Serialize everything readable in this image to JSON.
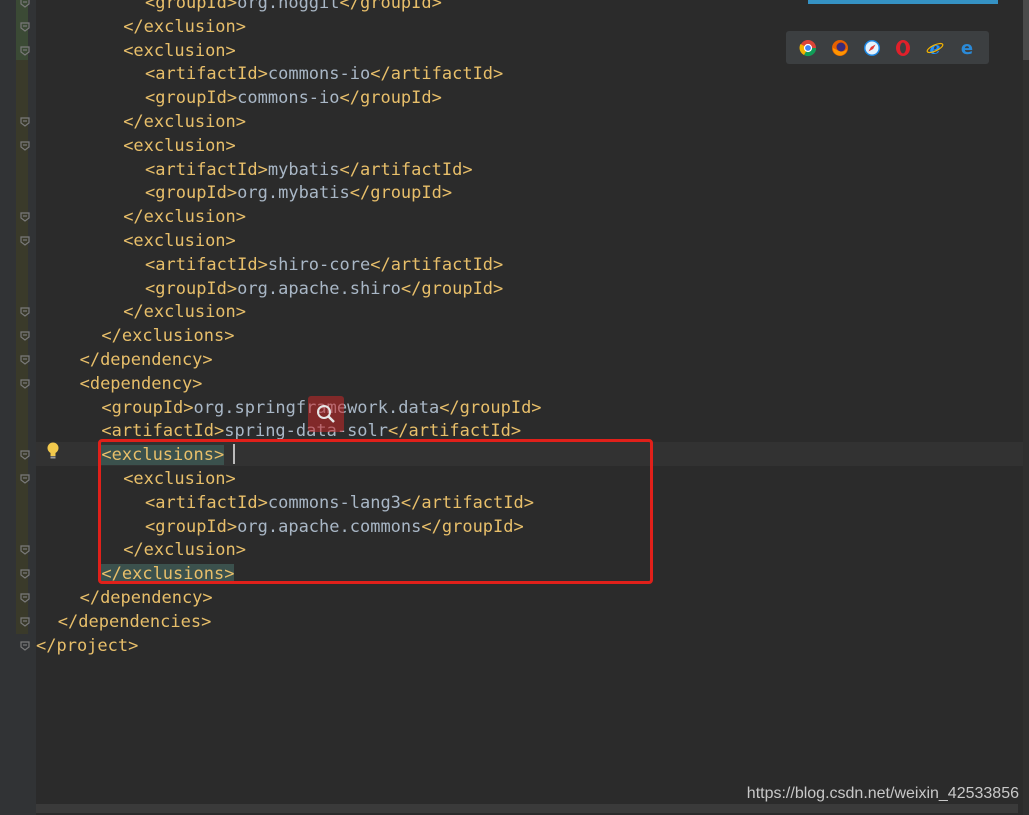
{
  "browser_icons": [
    "chrome-icon",
    "firefox-icon",
    "safari-icon",
    "opera-icon",
    "ie-icon",
    "edge-icon"
  ],
  "code_lines": [
    {
      "open": "<",
      "tag": "groupId",
      "mid": ">",
      "text": "org.hoggit",
      "close": "</groupId>"
    },
    {
      "tag_only": "</exclusion>"
    },
    {
      "tag_only": "<exclusion>"
    },
    {
      "open": "<",
      "tag": "artifactId",
      "mid": ">",
      "text": "commons-io",
      "close": "</artifactId>"
    },
    {
      "open": "<",
      "tag": "groupId",
      "mid": ">",
      "text": "commons-io",
      "close": "</groupId>"
    },
    {
      "tag_only": "</exclusion>"
    },
    {
      "tag_only": "<exclusion>"
    },
    {
      "open": "<",
      "tag": "artifactId",
      "mid": ">",
      "text": "mybatis",
      "close": "</artifactId>"
    },
    {
      "open": "<",
      "tag": "groupId",
      "mid": ">",
      "text": "org.mybatis",
      "close": "</groupId>"
    },
    {
      "tag_only": "</exclusion>"
    },
    {
      "tag_only": "<exclusion>"
    },
    {
      "open": "<",
      "tag": "artifactId",
      "mid": ">",
      "text": "shiro-core",
      "close": "</artifactId>"
    },
    {
      "open": "<",
      "tag": "groupId",
      "mid": ">",
      "text": "org.apache.shiro",
      "close": "</groupId>"
    },
    {
      "tag_only": "</exclusion>"
    },
    {
      "tag_only": "</exclusions>"
    },
    {
      "tag_only": "</dependency>"
    },
    {
      "tag_only": "<dependency>"
    },
    {
      "open": "<",
      "tag": "groupId",
      "mid": ">",
      "text": "org.springframework.data",
      "close": "</groupId>"
    },
    {
      "open": "<",
      "tag": "artifactId",
      "mid": ">",
      "text": "spring-data-solr",
      "close": "</artifactId>"
    },
    {
      "tag_only": "<exclusions>"
    },
    {
      "tag_only": "<exclusion>"
    },
    {
      "open": "<",
      "tag": "artifactId",
      "mid": ">",
      "text": "commons-lang3",
      "close": "</artifactId>"
    },
    {
      "open": "<",
      "tag": "groupId",
      "mid": ">",
      "text": "org.apache.commons",
      "close": "</groupId>"
    },
    {
      "tag_only": "</exclusion>"
    },
    {
      "tag_only": "</exclusions>"
    },
    {
      "tag_only": "</dependency>"
    },
    {
      "tag_only": "</dependencies>"
    },
    {
      "tag_only": "</project>"
    }
  ],
  "watermark": "https://blog.csdn.net/weixin_42533856",
  "colors": {
    "tag": "#e8bf6a",
    "text": "#a9b7c6",
    "highlight_box": "#e0201a",
    "background": "#2b2b2b"
  }
}
